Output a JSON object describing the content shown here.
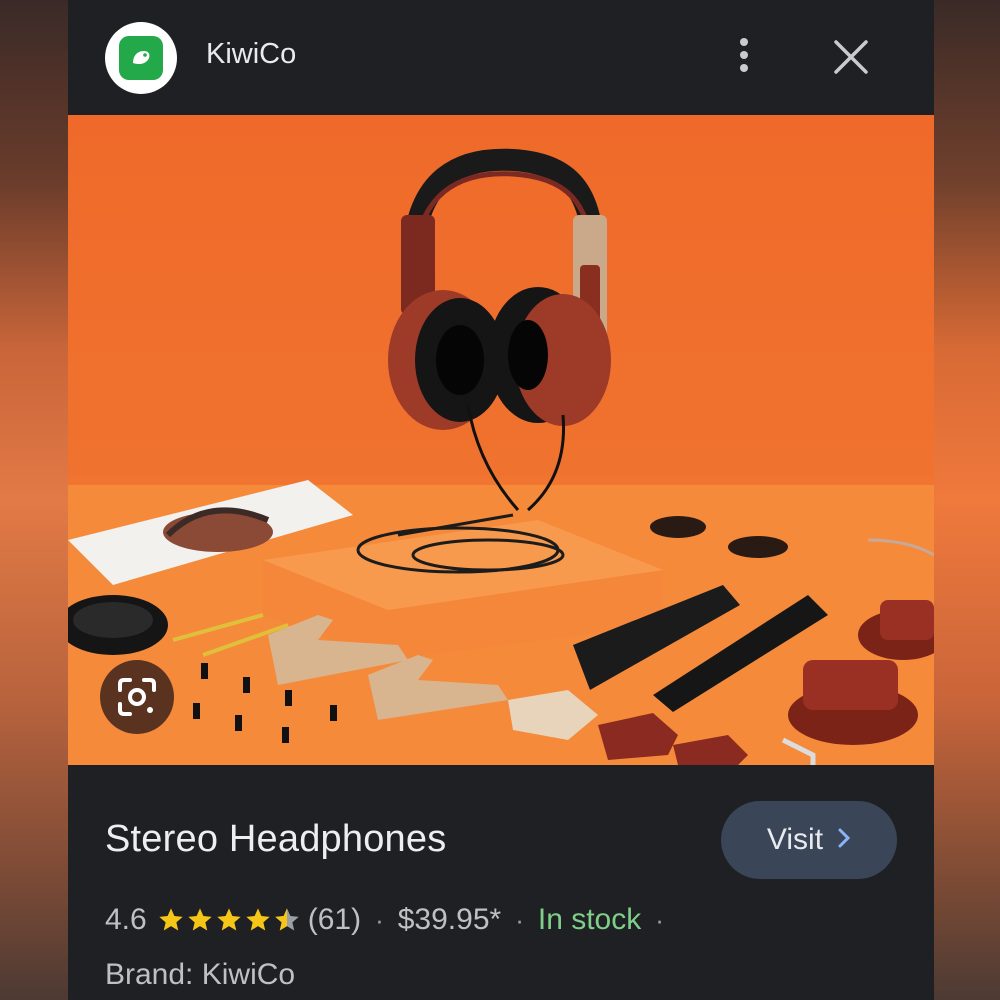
{
  "header": {
    "site_name": "KiwiCo",
    "logo_icon": "kiwico-logo-icon",
    "more_icon": "more-vert-icon",
    "close_icon": "close-icon"
  },
  "product": {
    "title": "Stereo Headphones",
    "rating": "4.6",
    "rating_value": 4.6,
    "review_count": "(61)",
    "price": "$39.95*",
    "availability": "In stock",
    "trailing_dot": "·",
    "brand": "Brand: KiwiCo"
  },
  "visit_button": {
    "label": "Visit",
    "icon": "chevron-right-icon"
  },
  "lens_button": {
    "icon": "google-lens-icon"
  },
  "colors": {
    "accent_button": "#3b4558",
    "in_stock": "#7fce8a",
    "star": "#f5c518",
    "background": "#1f2023"
  }
}
